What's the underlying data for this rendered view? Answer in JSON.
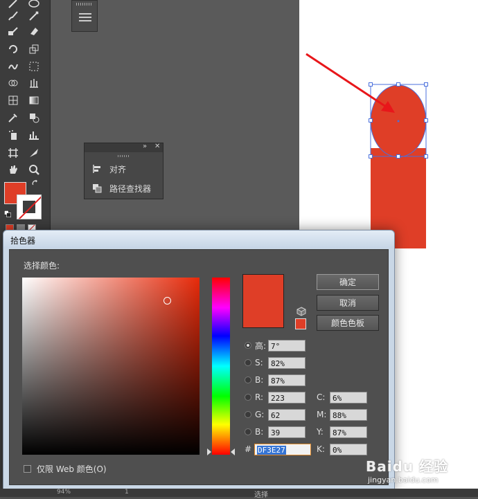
{
  "colors": {
    "fill": "#df3e27",
    "hue_pure": "#e72a0a",
    "selection": "#4a6fdc",
    "arrow": "#e8161a"
  },
  "align_panel": {
    "items": [
      {
        "label": "对齐",
        "icon": "align-icon"
      },
      {
        "label": "路径查找器",
        "icon": "pathfinder-icon"
      }
    ]
  },
  "picker": {
    "title": "拾色器",
    "select_label": "选择颜色:",
    "buttons": {
      "ok": "确定",
      "cancel": "取消",
      "swatches": "颜色色板"
    },
    "hsb": [
      {
        "label": "高:",
        "value": "7°",
        "selected": true
      },
      {
        "label": "S:",
        "value": "82%",
        "selected": false
      },
      {
        "label": "B:",
        "value": "87%",
        "selected": false
      }
    ],
    "rgb": [
      {
        "label": "R:",
        "value": "223"
      },
      {
        "label": "G:",
        "value": "62"
      },
      {
        "label": "B:",
        "value": "39"
      }
    ],
    "cmyk": [
      {
        "label": "C:",
        "value": "6%"
      },
      {
        "label": "M:",
        "value": "88%"
      },
      {
        "label": "Y:",
        "value": "87%"
      },
      {
        "label": "K:",
        "value": "0%"
      }
    ],
    "hex_prefix": "#",
    "hex": "DF3E27",
    "web_only": "仅限 Web 颜色(O)"
  },
  "statusbar": {
    "zoom": "94%",
    "page": "1",
    "text": "选择"
  },
  "watermark": {
    "logo": "Baidu 经验",
    "url": "jingyan.baidu.com"
  }
}
